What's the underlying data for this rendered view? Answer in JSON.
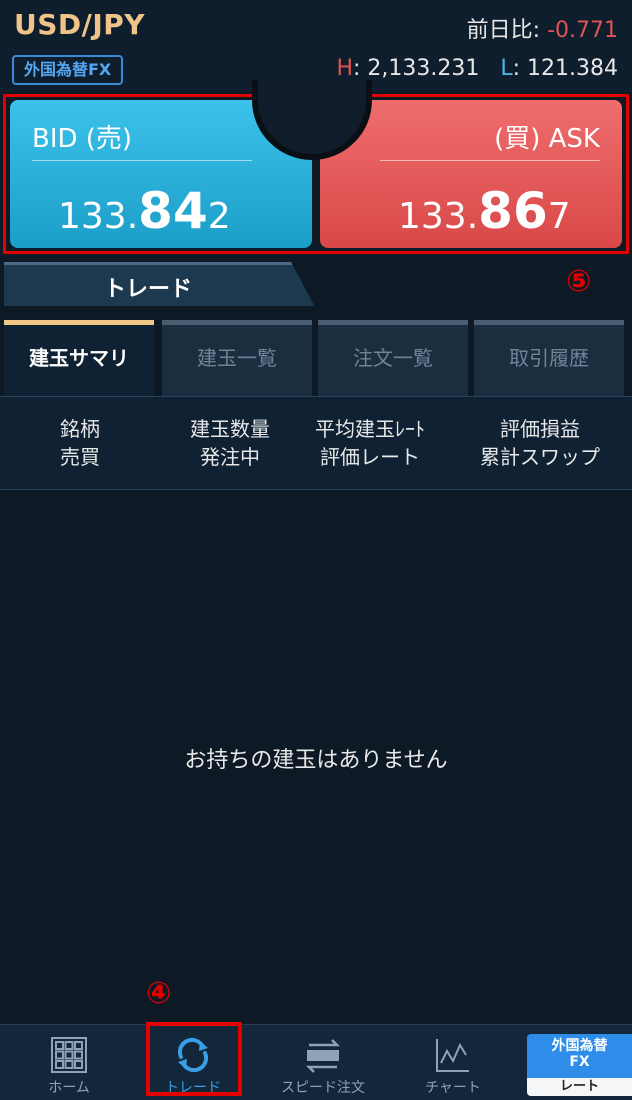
{
  "header": {
    "pair": "USD/JPY",
    "prev_label": "前日比:",
    "prev_value": "-0.771",
    "tag": "外国為替FX",
    "high_label": "H",
    "high_value": ": 2,133.231",
    "low_label": "L",
    "low_value": ": 121.384"
  },
  "quote": {
    "bid_label": "BID (売)",
    "bid_price_prefix": "133.",
    "bid_price_big": "84",
    "bid_price_suffix": "2",
    "ask_label": "(買) ASK",
    "ask_price_prefix": "133.",
    "ask_price_big": "86",
    "ask_price_suffix": "7"
  },
  "trade_tab": "トレード",
  "annotation_5": "⑤",
  "annotation_4": "④",
  "tabs": [
    {
      "label": "建玉サマリ"
    },
    {
      "label": "建玉一覧"
    },
    {
      "label": "注文一覧"
    },
    {
      "label": "取引履歴"
    }
  ],
  "columns": [
    {
      "line1": "銘柄",
      "line2": "売買"
    },
    {
      "line1": "建玉数量",
      "line2": "発注中"
    },
    {
      "line1": "平均建玉ﾚｰﾄ",
      "line2": "評価レート"
    },
    {
      "line1": "評価損益",
      "line2": "累計スワップ"
    }
  ],
  "empty_message": "お持ちの建玉はありません",
  "nav": {
    "items": [
      {
        "label": "ホーム",
        "icon": "grid-icon"
      },
      {
        "label": "トレード",
        "icon": "refresh-icon"
      },
      {
        "label": "スピード注文",
        "icon": "speed-icon"
      },
      {
        "label": "チャート",
        "icon": "chart-icon"
      }
    ],
    "fx_top": "外国為替\nFX",
    "fx_bottom": "レート"
  },
  "colors": {
    "accent": "#3a9de6",
    "bid": "#1b9ec8",
    "ask": "#d94848",
    "highlight_box": "#e20000"
  }
}
